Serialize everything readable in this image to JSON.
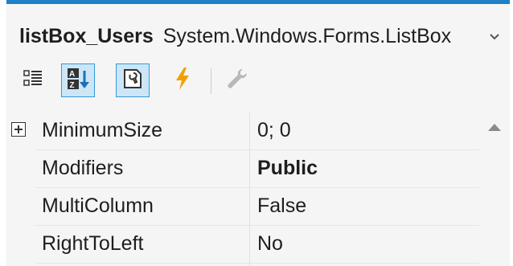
{
  "selector": {
    "object_name": "listBox_Users",
    "object_type": "System.Windows.Forms.ListBox",
    "dropdown_icon": "chevron-down-icon"
  },
  "toolbar": {
    "buttons": [
      {
        "name": "categorized-icon",
        "active": false
      },
      {
        "name": "alphabetical-sort-icon",
        "active": true
      },
      {
        "name": "properties-icon",
        "active": true
      },
      {
        "name": "events-lightning-icon",
        "active": false
      },
      {
        "name": "property-pages-wrench-icon",
        "active": false
      }
    ]
  },
  "properties": [
    {
      "name": "MinimumSize",
      "value": "0; 0",
      "expandable": true,
      "bold": false
    },
    {
      "name": "Modifiers",
      "value": "Public",
      "expandable": false,
      "bold": true
    },
    {
      "name": "MultiColumn",
      "value": "False",
      "expandable": false,
      "bold": false
    },
    {
      "name": "RightToLeft",
      "value": "No",
      "expandable": false,
      "bold": false
    }
  ],
  "colors": {
    "accent": "#1f7fc7",
    "lightning": "#f0a000",
    "panel_bg": "#f5f5f5"
  }
}
